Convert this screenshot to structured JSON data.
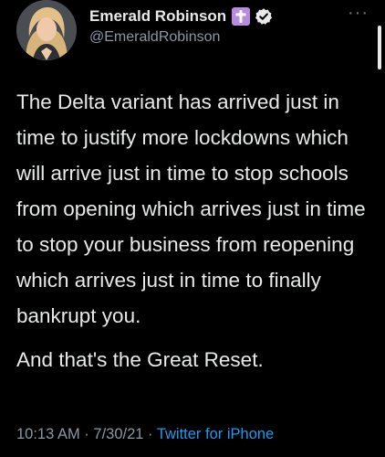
{
  "author": {
    "display_name": "Emerald Robinson",
    "handle": "@EmeraldRobinson",
    "badge_icon": "cross-icon",
    "verified_icon": "verified-check-icon"
  },
  "tweet": {
    "paragraph_1": "The Delta variant has arrived just in time to justify more lockdowns which will arrive just in time to stop schools from opening which arrives just in time to stop your business from reopening which arrives just in time to finally bankrupt you.",
    "paragraph_2": "And that's the Great Reset."
  },
  "meta": {
    "time": "10:13 AM",
    "separator_1": " · ",
    "date": "7/30/21",
    "separator_2": " · ",
    "source": "Twitter for iPhone"
  },
  "header": {
    "more_label": "···"
  },
  "colors": {
    "background": "#000000",
    "text": "#e7e9ea",
    "secondary": "#8b98a5",
    "link": "#1d9bf0",
    "badge": "#b78be0"
  }
}
